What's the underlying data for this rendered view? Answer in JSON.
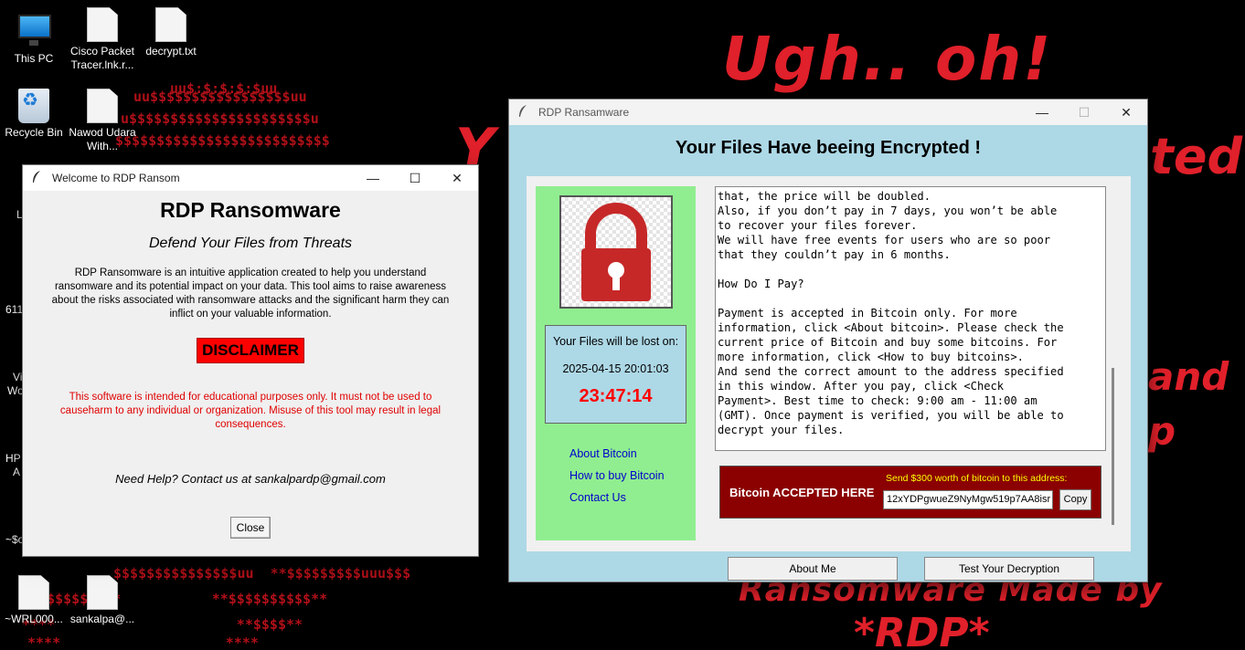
{
  "desktop": {
    "icons": [
      {
        "label": "This PC"
      },
      {
        "label": "Cisco Packet Tracer.lnk.r..."
      },
      {
        "label": "decrypt.txt"
      },
      {
        "label": "Recycle Bin"
      },
      {
        "label": "Nawod Udara With..."
      },
      {
        "label": "~WRL000..."
      },
      {
        "label": "sankalpa@..."
      }
    ],
    "clipped_labels": [
      "L",
      "611",
      "Vi",
      "Wo",
      "HP",
      "A",
      "~$o"
    ],
    "wallpaper": {
      "ugh": "Ugh.. oh!",
      "side_y": "Y",
      "side_r": "ted",
      "and": "and",
      "p": "p",
      "made_by": "Ransomware Made by",
      "rdp": "*RDP*",
      "ascii_lines": [
        "uu$:$:$:$:$uu",
        "uu$$$$$$$$$$$$$$$$$uu",
        "u$$$$$$$$$$$$$$$$$$$$$$u",
        "$$$$$$$$$$$$$$$$$$$$$$$$$$"
      ]
    }
  },
  "welcome": {
    "window_title": "Welcome to RDP Ransom",
    "heading": "RDP Ransomware",
    "subheading": "Defend Your Files from Threats",
    "description": "RDP Ransomware is an intuitive application created to help you understand ransomware and its potential impact on your data. This tool aims to raise awareness about the risks associated with ransomware attacks and the significant harm they can inflict on your valuable information.",
    "disclaimer_label": "DISCLAIMER",
    "warning": "This software is intended for educational purposes only. It must not be used to causeharm to any individual or organization. Misuse of this tool may result in legal consequences.",
    "help": "Need Help? Contact us at sankalpardp@gmail.com",
    "close_label": "Close"
  },
  "ransom": {
    "window_title": "RDP Ransamware",
    "heading": "Your Files Have beeing Encrypted !",
    "timer_label": "Your Files will be lost on:",
    "deadline": "2025-04-15 20:01:03",
    "countdown": "23:47:14",
    "links": [
      "About Bitcoin",
      "How to buy Bitcoin",
      "Contact Us"
    ],
    "message": "that, the price will be doubled.\nAlso, if you don’t pay in 7 days, you won’t be able\nto recover your files forever.\nWe will have free events for users who are so poor\nthat they couldn’t pay in 6 months.\n\nHow Do I Pay?\n\nPayment is accepted in Bitcoin only. For more\ninformation, click <About bitcoin>. Please check the\ncurrent price of Bitcoin and buy some bitcoins. For\nmore information, click <How to buy bitcoins>.\nAnd send the correct amount to the address specified\nin this window. After you pay, click <Check\nPayment>. Best time to check: 9:00 am - 11:00 am\n(GMT). Once payment is verified, you will be able to\ndecrypt your files.",
    "bitcoin_label": "Bitcoin ACCEPTED HERE",
    "send_text": "Send $300 worth of bitcoin to this address:",
    "address": "12xYDPgwueZ9NyMgw519p7AA8isr",
    "copy_label": "Copy",
    "about_me_label": "About Me",
    "test_label": "Test Your Decryption"
  },
  "colors": {
    "wallpaper_red": "#e0202a",
    "ransom_bg": "#add8e6",
    "green_panel": "#90ee90",
    "bitcoin_box": "#8b0000",
    "countdown": "#ff0000",
    "disclaimer": "#ff0000",
    "link": "#0000cc"
  }
}
